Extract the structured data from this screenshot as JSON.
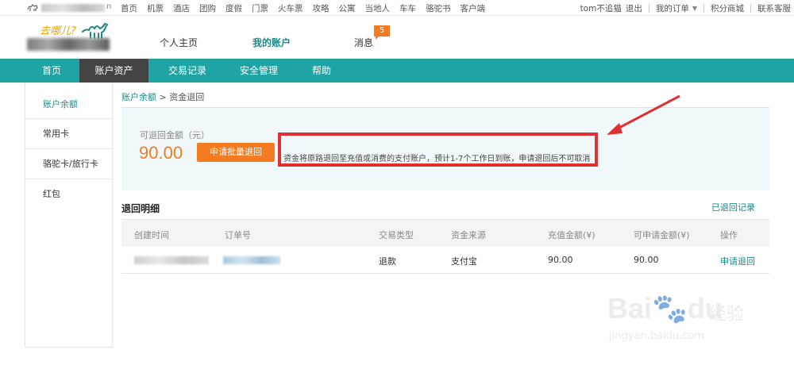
{
  "topbar": {
    "site_suffix": "n",
    "links": [
      "首页",
      "机票",
      "酒店",
      "团购",
      "度假",
      "门票",
      "火车票",
      "攻略",
      "公寓",
      "当地人",
      "车车",
      "骆驼书",
      "客户端"
    ],
    "user": "tom不追猫",
    "logout": "退出",
    "my_orders": "我的订单",
    "points_mall": "积分商城",
    "contact": "联系客服"
  },
  "header": {
    "logo_text": "去哪儿?",
    "nav": [
      {
        "label": "个人主页"
      },
      {
        "label": "我的账户"
      },
      {
        "label": "消息"
      }
    ],
    "message_badge": "5"
  },
  "mainnav": {
    "items": [
      "首页",
      "账户资产",
      "交易记录",
      "安全管理",
      "帮助"
    ]
  },
  "sidebar": {
    "items": [
      "账户余额",
      "常用卡",
      "骆驼卡/旅行卡",
      "红包"
    ]
  },
  "breadcrumb": {
    "link": "账户余额",
    "sep": ">",
    "current": "资金退回"
  },
  "refund_panel": {
    "label": "可退回金额（元）",
    "amount": "90.00",
    "button": "申请批量退回",
    "notice": "资金将原路退回至充值或消费的支付账户，预计1-7个工作日到账，申请退回后不可取消"
  },
  "details": {
    "title": "退回明细",
    "history_link": "已退回记录",
    "columns": [
      "创建时间",
      "订单号",
      "交易类型",
      "资金来源",
      "充值金额(¥)",
      "可申请金额(¥)",
      "操作"
    ],
    "rows": [
      {
        "type": "退款",
        "source": "支付宝",
        "recharge": "90.00",
        "available": "90.00",
        "action": "申请退回"
      }
    ]
  },
  "watermark": {
    "brand": "Bai",
    "brand2": "du",
    "cn": "经验",
    "url": "jingyan.baidu.com"
  },
  "colors": {
    "teal": "#1fa3a3",
    "accent_orange": "#f47b20",
    "annotation_red": "#e03030"
  }
}
